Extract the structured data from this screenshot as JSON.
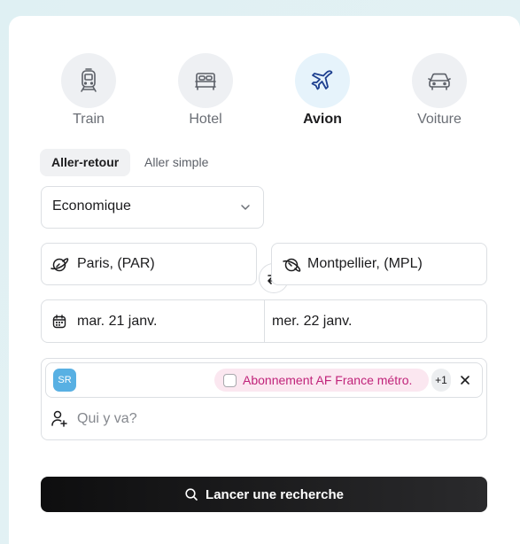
{
  "modes": [
    {
      "label": "Train",
      "icon": "train-icon",
      "active": false
    },
    {
      "label": "Hotel",
      "icon": "bed-icon",
      "active": false
    },
    {
      "label": "Avion",
      "icon": "plane-icon",
      "active": true
    },
    {
      "label": "Voiture",
      "icon": "car-icon",
      "active": false
    }
  ],
  "trip_type": {
    "round_trip": "Aller-retour",
    "one_way": "Aller simple",
    "selected": "Aller-retour"
  },
  "cabin_class": {
    "value": "Economique"
  },
  "origin": {
    "value": "Paris, (PAR)"
  },
  "destination": {
    "value": "Montpellier, (MPL)"
  },
  "dates": {
    "depart": "mar. 21 janv.",
    "return": "mer. 22 janv."
  },
  "travelers": {
    "avatar_initials": "SR",
    "subscription": "Abonnement AF France métro.",
    "extra_count": "+1",
    "placeholder": "Qui y va?"
  },
  "search_button": {
    "label": "Lancer une recherche"
  },
  "colors": {
    "accent_blue": "#1d3f8f",
    "chip_pink": "#c0237a",
    "avatar": "#58b0e3"
  }
}
